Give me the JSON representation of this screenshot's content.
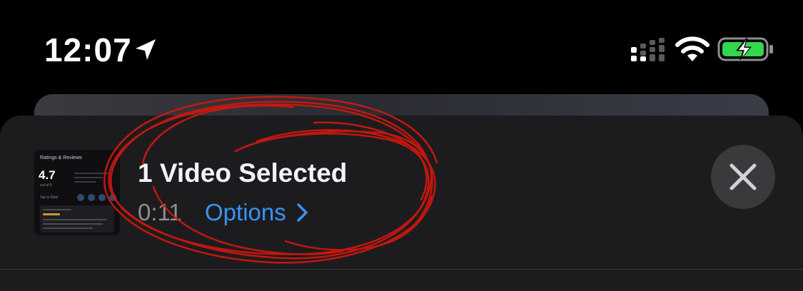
{
  "status_bar": {
    "time": "12:07",
    "icons": [
      "location-arrow-icon",
      "cellular-signal-icon",
      "wifi-icon",
      "battery-charging-icon"
    ],
    "battery_color": "#32d74b"
  },
  "selection": {
    "title": "1 Video Selected",
    "duration": "0:11",
    "options_label": "Options"
  },
  "thumbnail": {
    "heading": "Ratings & Reviews",
    "rating": "4.7",
    "subtext": "out of 5",
    "tap_text": "Tap to Rate"
  },
  "annotation": {
    "type": "freehand-scribble",
    "color": "#d0170e"
  },
  "colors": {
    "background": "#000000",
    "sheet": "#1c1c1e",
    "accent": "#3a93f5",
    "secondary_text": "#8e8e93",
    "primary_text": "#f2f2f7"
  }
}
